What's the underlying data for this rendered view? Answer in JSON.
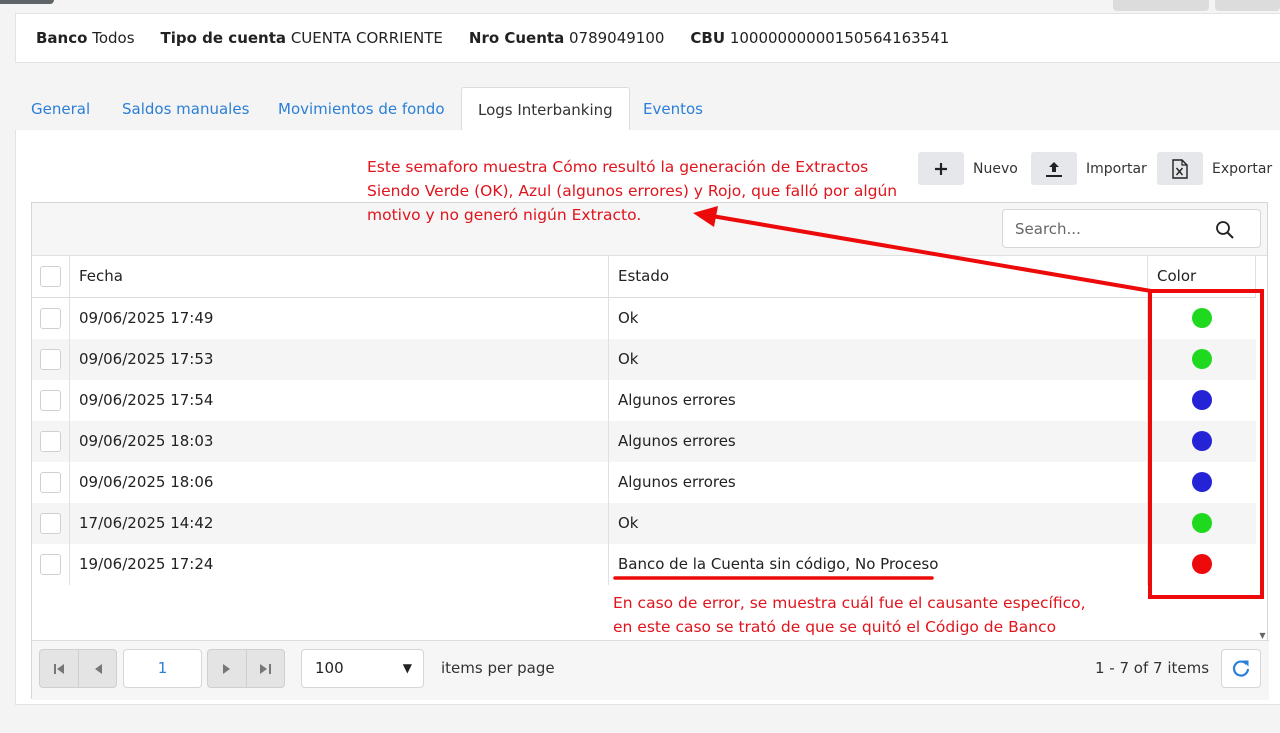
{
  "info": {
    "banco_label": "Banco",
    "banco_value": "Todos",
    "tipo_label": "Tipo de cuenta",
    "tipo_value": "CUENTA CORRIENTE",
    "nro_label": "Nro Cuenta",
    "nro_value": "0789049100",
    "cbu_label": "CBU",
    "cbu_value": "10000000000150564163541"
  },
  "tabs": [
    {
      "label": "General",
      "active": false
    },
    {
      "label": "Saldos manuales",
      "active": false
    },
    {
      "label": "Movimientos de fondo",
      "active": false
    },
    {
      "label": "Logs Interbanking",
      "active": true
    },
    {
      "label": "Eventos",
      "active": false
    }
  ],
  "toolbar": {
    "nuevo_label": "Nuevo",
    "importar_label": "Importar",
    "exportar_label": "Exportar"
  },
  "search": {
    "placeholder": "Search...",
    "value": ""
  },
  "grid": {
    "columns": [
      "Fecha",
      "Estado",
      "Color"
    ],
    "rows": [
      {
        "fecha": "09/06/2025 17:49",
        "estado": "Ok",
        "color": "#1ed91e"
      },
      {
        "fecha": "09/06/2025 17:53",
        "estado": "Ok",
        "color": "#1ed91e"
      },
      {
        "fecha": "09/06/2025 17:54",
        "estado": "Algunos errores",
        "color": "#2424d6"
      },
      {
        "fecha": "09/06/2025 18:03",
        "estado": "Algunos errores",
        "color": "#2424d6"
      },
      {
        "fecha": "09/06/2025 18:06",
        "estado": "Algunos errores",
        "color": "#2424d6"
      },
      {
        "fecha": "17/06/2025 14:42",
        "estado": "Ok",
        "color": "#1ed91e"
      },
      {
        "fecha": "19/06/2025 17:24",
        "estado": "Banco de la Cuenta sin código, No Proceso",
        "color": "#ec0a0a"
      }
    ]
  },
  "pager": {
    "current_page": "1",
    "page_size": "100",
    "items_per_page_label": "items per page",
    "info": "1 - 7 of 7 items"
  },
  "annotations": {
    "top_line1": "Este semaforo muestra Cómo resultó la generación de Extractos",
    "top_line2": "Siendo Verde (OK), Azul (algunos errores) y Rojo, que falló por algún",
    "top_line3": "motivo y no generó nigún Extracto.",
    "bottom_line1": "En caso de error, se muestra cuál fue el causante específico,",
    "bottom_line2": "en este caso se trató de que se quitó el Código de Banco"
  },
  "colors": {
    "accent": "#2b7fd6",
    "annotation": "#e0141c"
  }
}
